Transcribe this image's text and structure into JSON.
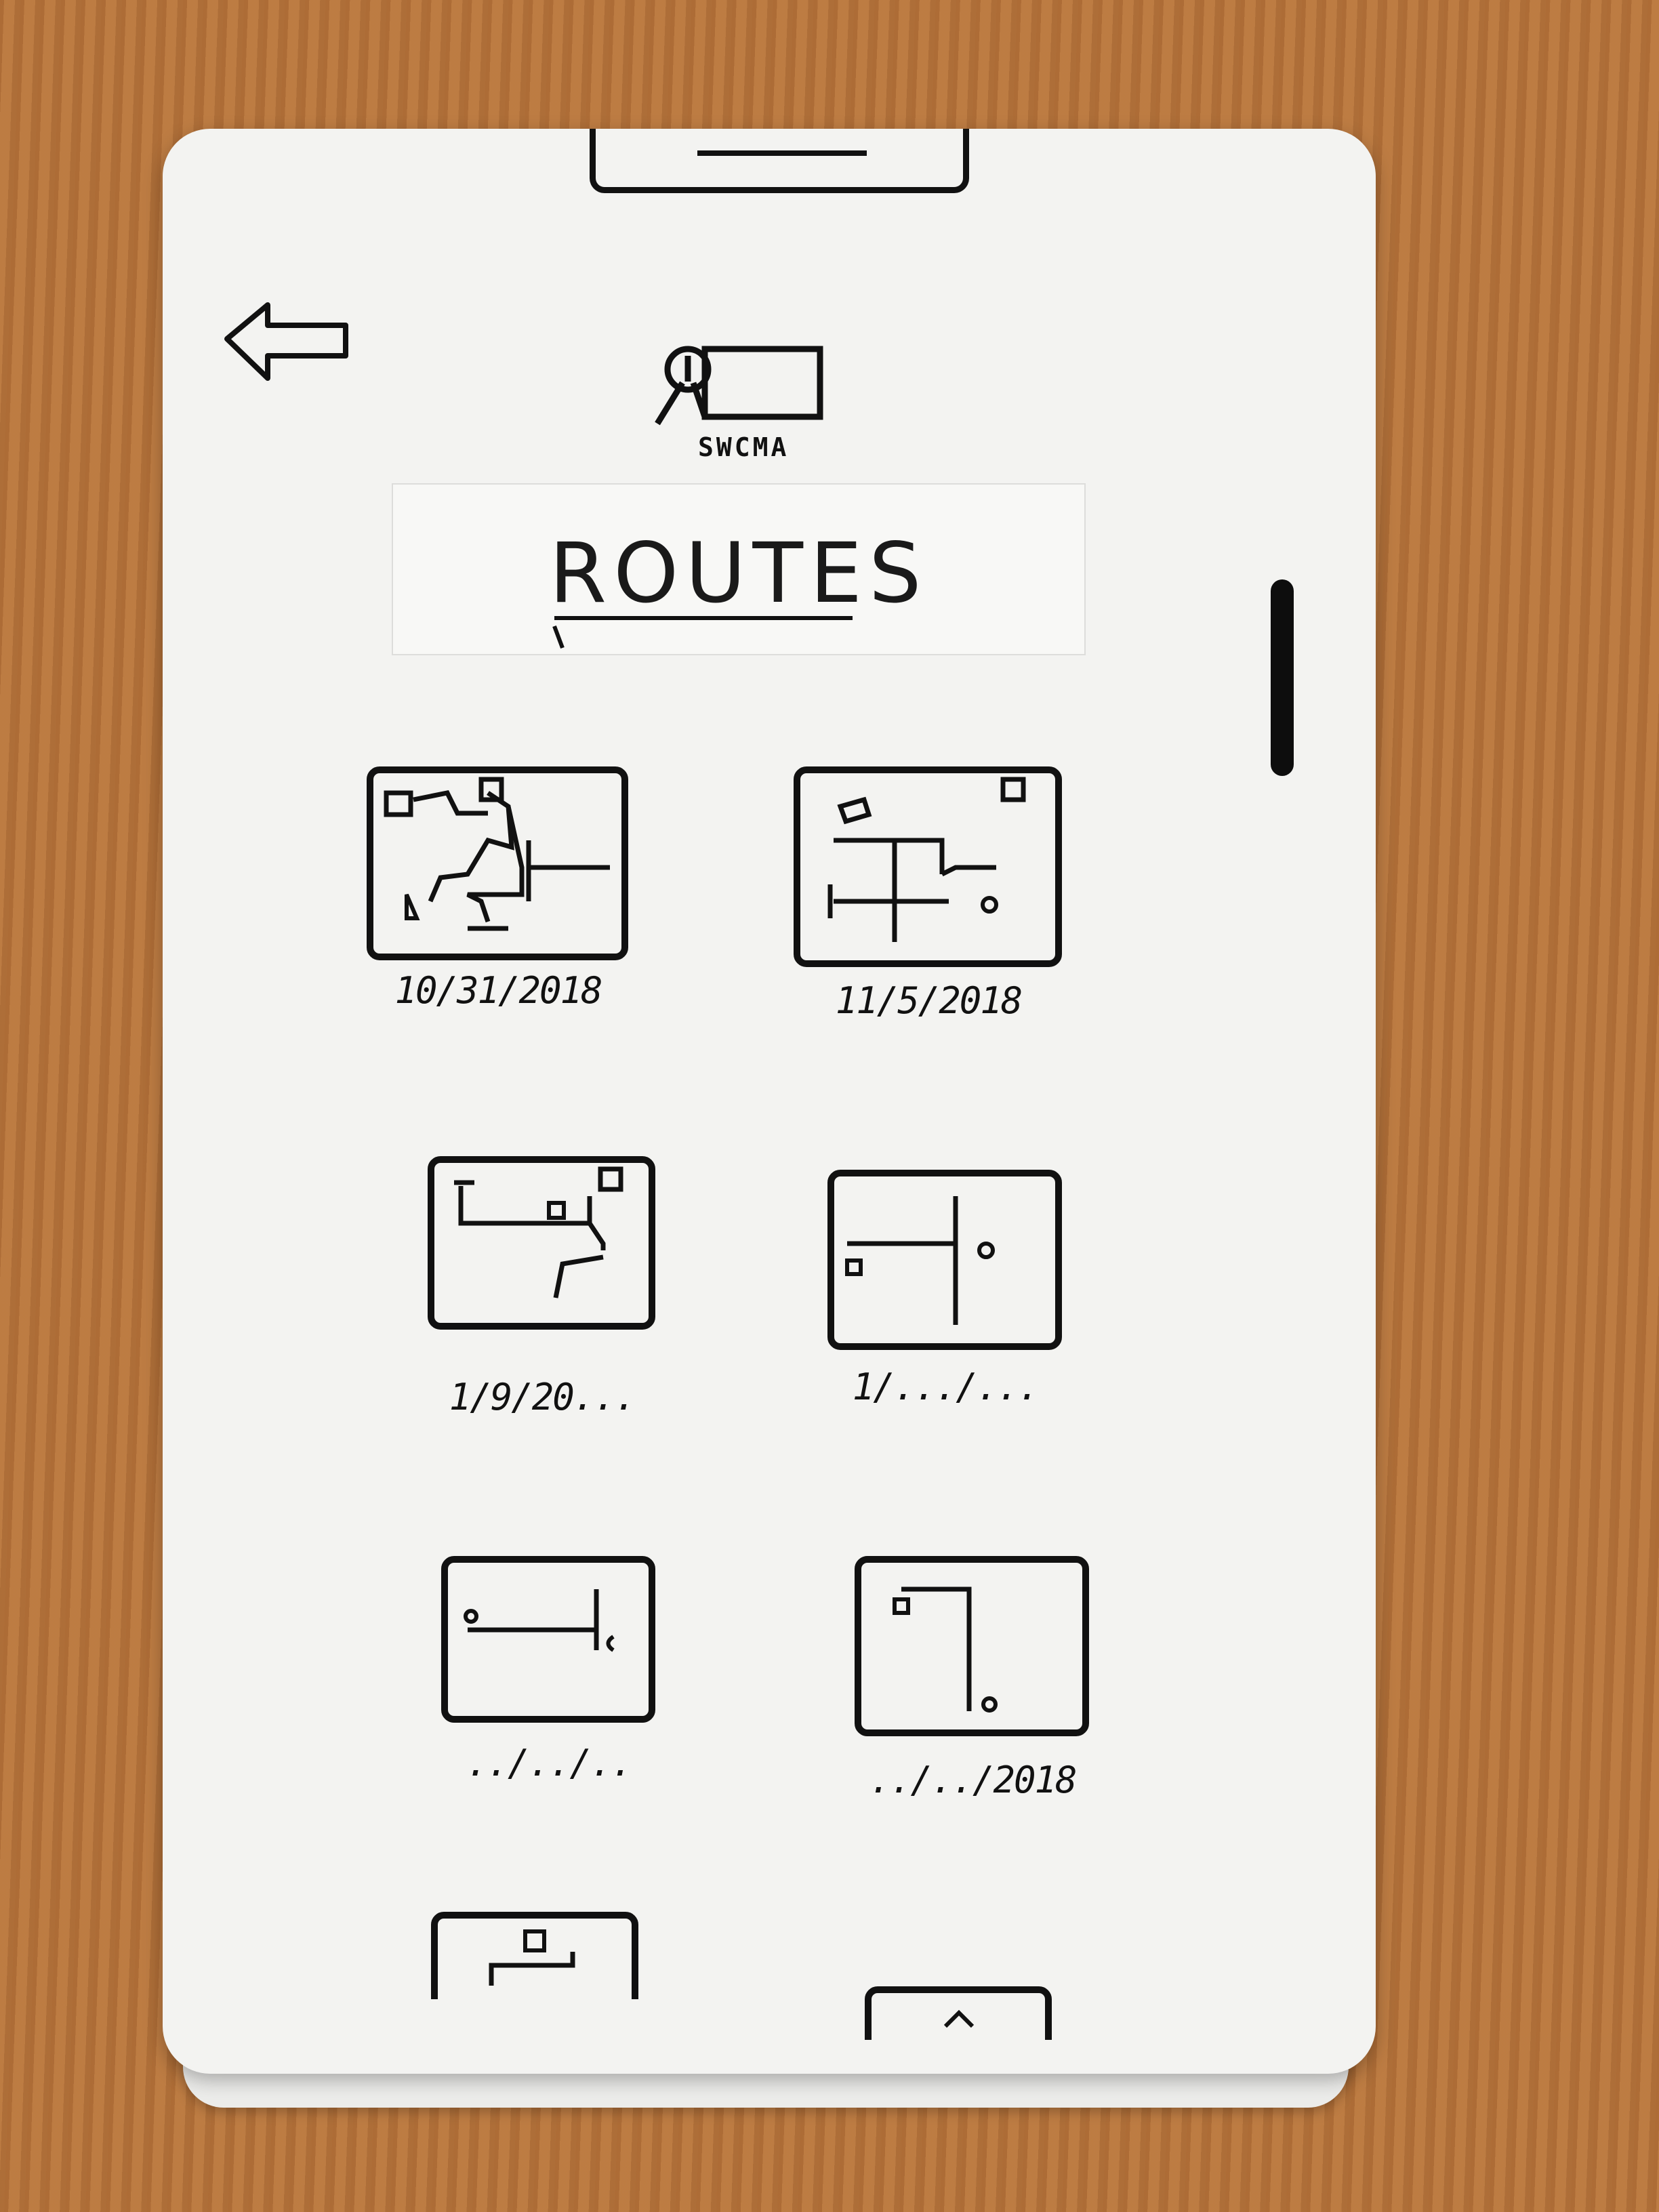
{
  "app": {
    "logo_text": "SWCMA",
    "title": "ROUTES"
  },
  "routes": [
    {
      "date": "10/31/2018"
    },
    {
      "date": "11/5/2018"
    },
    {
      "date": "1/9/20..."
    },
    {
      "date": "1/.../..."
    },
    {
      "date": "../../.."
    },
    {
      "date": "../../2018"
    }
  ],
  "icons": {
    "back": "left-arrow-icon",
    "logo": "swcma-logo-icon"
  }
}
